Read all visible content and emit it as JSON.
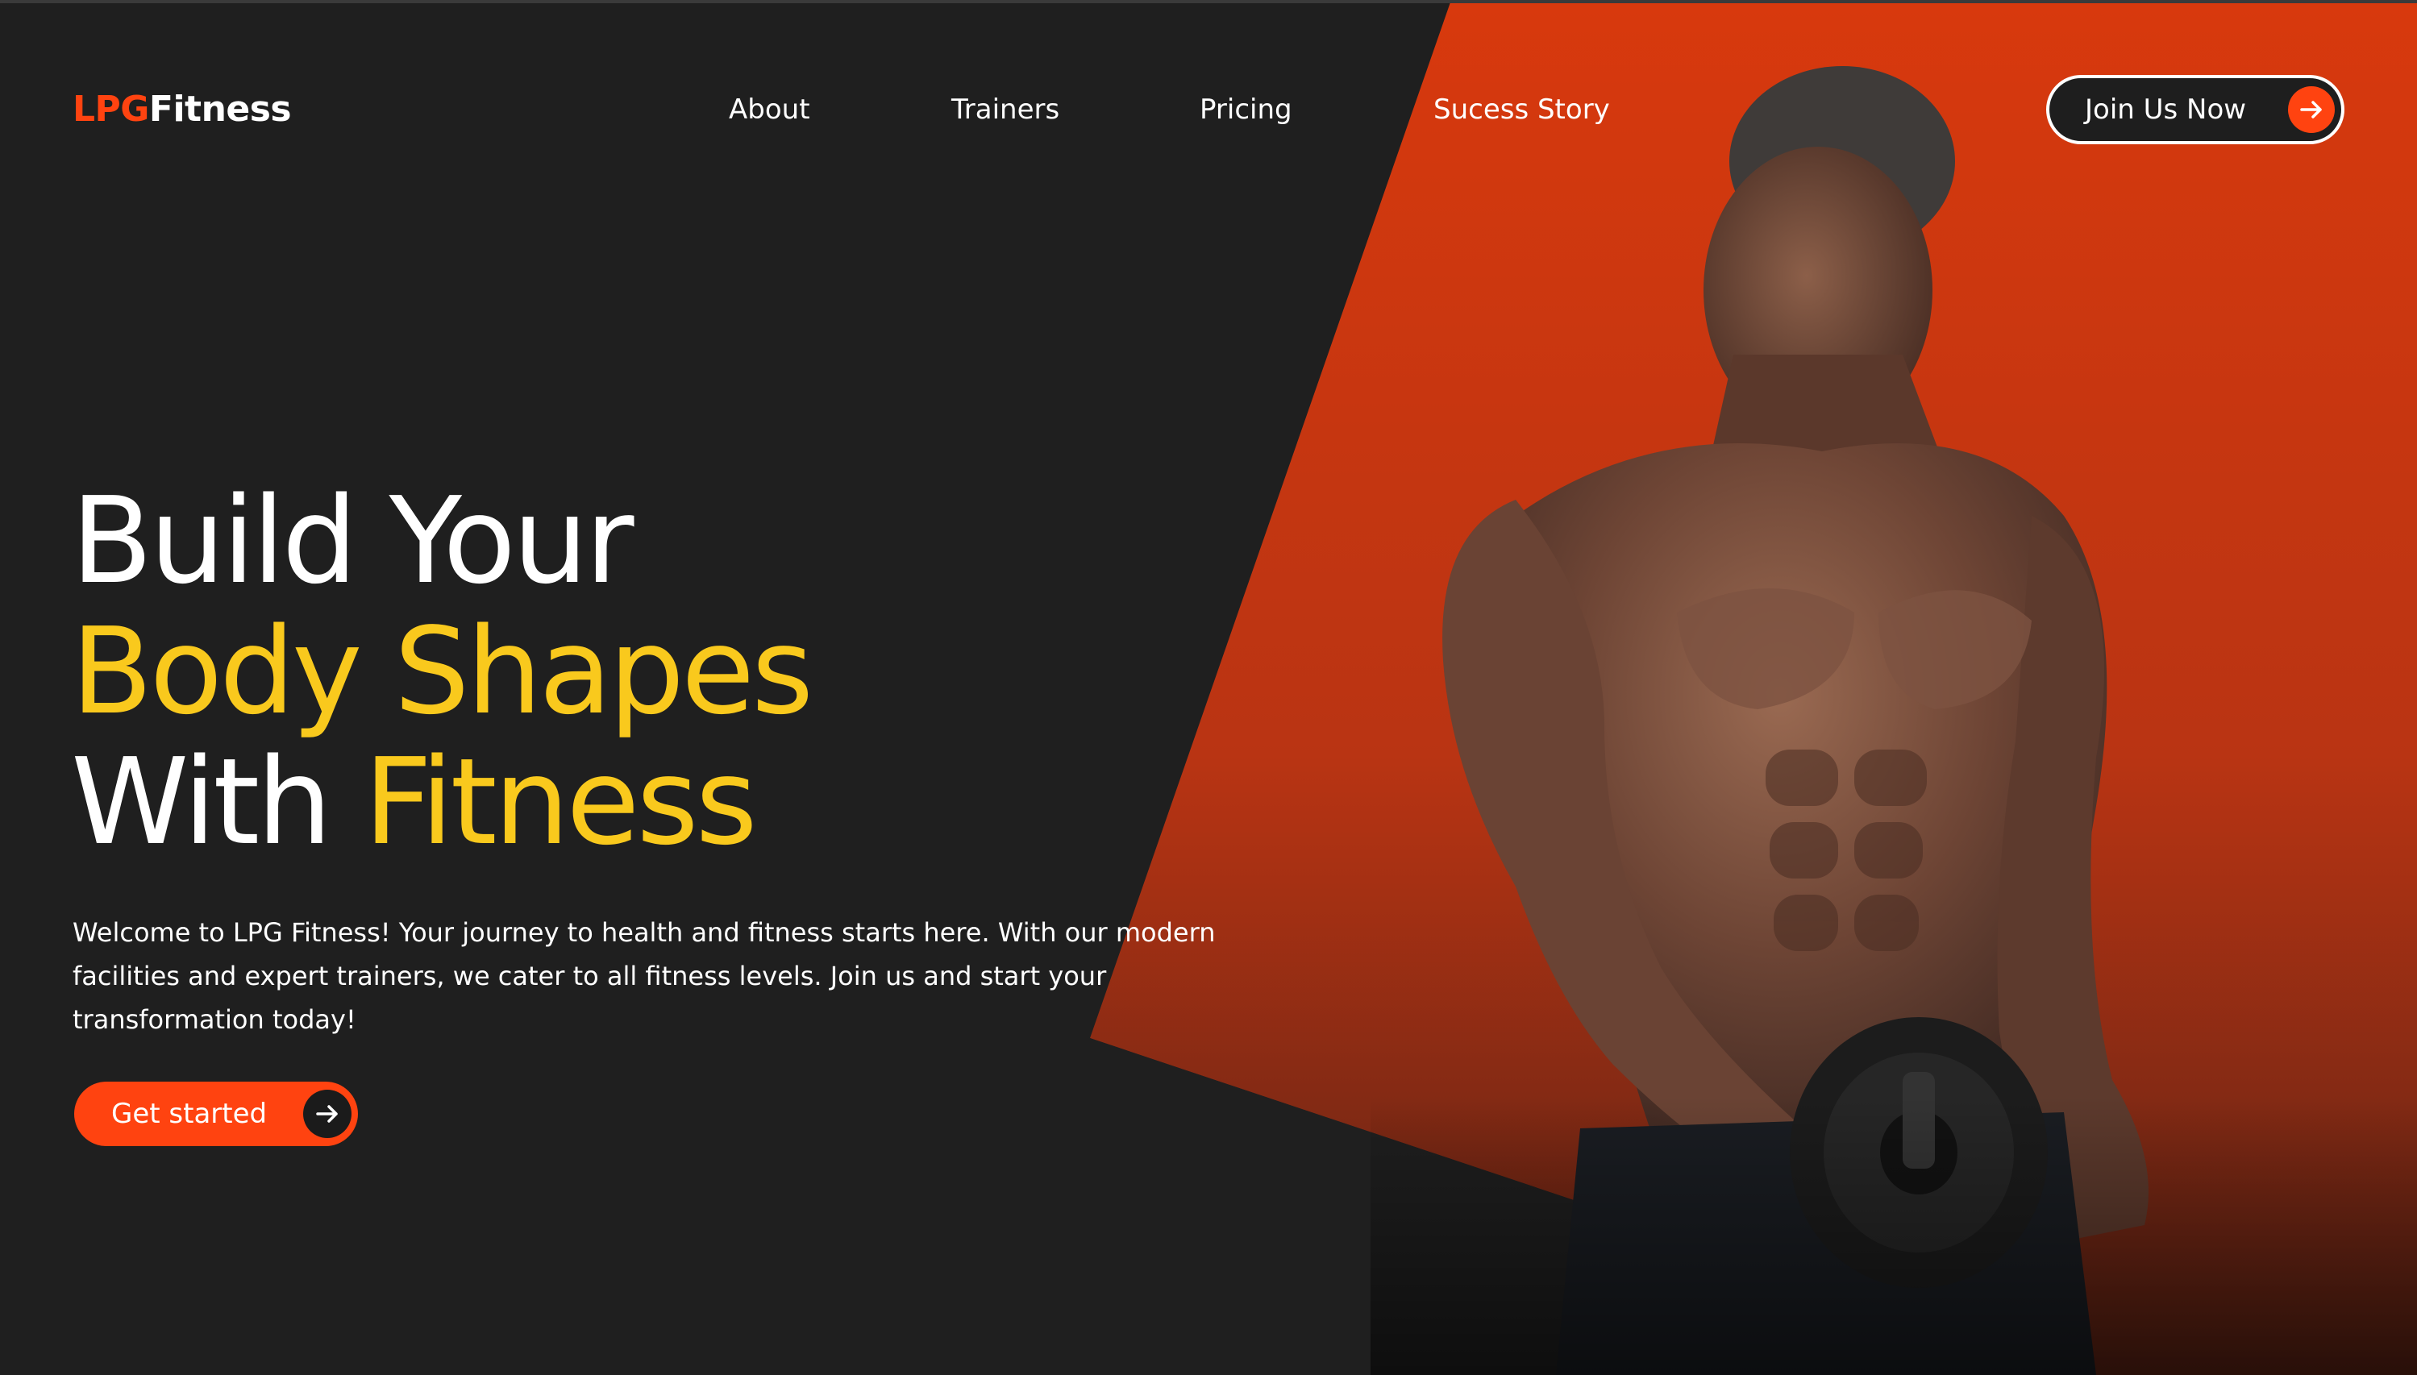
{
  "logo": {
    "accent": "LPG",
    "rest": "Fitness"
  },
  "nav": {
    "items": [
      {
        "label": "About"
      },
      {
        "label": "Trainers"
      },
      {
        "label": "Pricing"
      },
      {
        "label": "Sucess Story"
      }
    ],
    "join_label": "Join Us Now",
    "join_icon": "arrow-right-icon"
  },
  "hero": {
    "line1": "Build Your",
    "line2": "Body Shapes",
    "line3_white": "With",
    "line3_yellow": "Fitness",
    "intro": "Welcome to LPG Fitness! Your journey to health and fitness starts here. With our modern facilities and expert trainers, we cater to all fitness levels. Join us and start your transformation today!",
    "cta_label": "Get started",
    "cta_icon": "arrow-right-icon"
  },
  "colors": {
    "background": "#1f1f1f",
    "accent_orange": "#ff4310",
    "panel_orange": "#d8390d",
    "headline_yellow": "#f9c91d",
    "text": "#ffffff"
  }
}
